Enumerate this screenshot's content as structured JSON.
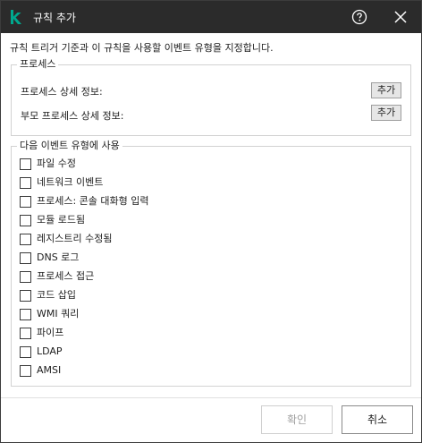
{
  "dialog": {
    "title": "규칙 추가",
    "description": "규칙 트리거 기준과 이 규칙을 사용할 이벤트 유형을 지정합니다."
  },
  "process_group": {
    "title": "프로세스",
    "rows": [
      {
        "label": "프로세스 상세 정보:",
        "button": "추가"
      },
      {
        "label": "부모 프로세스 상세 정보:",
        "button": "추가"
      }
    ]
  },
  "events_group": {
    "title": "다음 이벤트 유형에 사용",
    "items": [
      {
        "label": "파일 수정",
        "checked": false
      },
      {
        "label": "네트워크 이벤트",
        "checked": false
      },
      {
        "label": "프로세스: 콘솔 대화형 입력",
        "checked": false
      },
      {
        "label": "모듈 로드됨",
        "checked": false
      },
      {
        "label": "레지스트리 수정됨",
        "checked": false
      },
      {
        "label": "DNS 로그",
        "checked": false
      },
      {
        "label": "프로세스 접근",
        "checked": false
      },
      {
        "label": "코드 삽입",
        "checked": false
      },
      {
        "label": "WMI 쿼리",
        "checked": false
      },
      {
        "label": "파이프",
        "checked": false
      },
      {
        "label": "LDAP",
        "checked": false
      },
      {
        "label": "AMSI",
        "checked": false
      }
    ]
  },
  "footer": {
    "ok_label": "확인",
    "ok_enabled": false,
    "cancel_label": "취소"
  },
  "colors": {
    "titlebar": "#2b2b2b",
    "logo": "#00a88e"
  },
  "icons": {
    "logo": "kaspersky-k-logo",
    "help": "help-circle-icon",
    "close": "close-icon"
  }
}
